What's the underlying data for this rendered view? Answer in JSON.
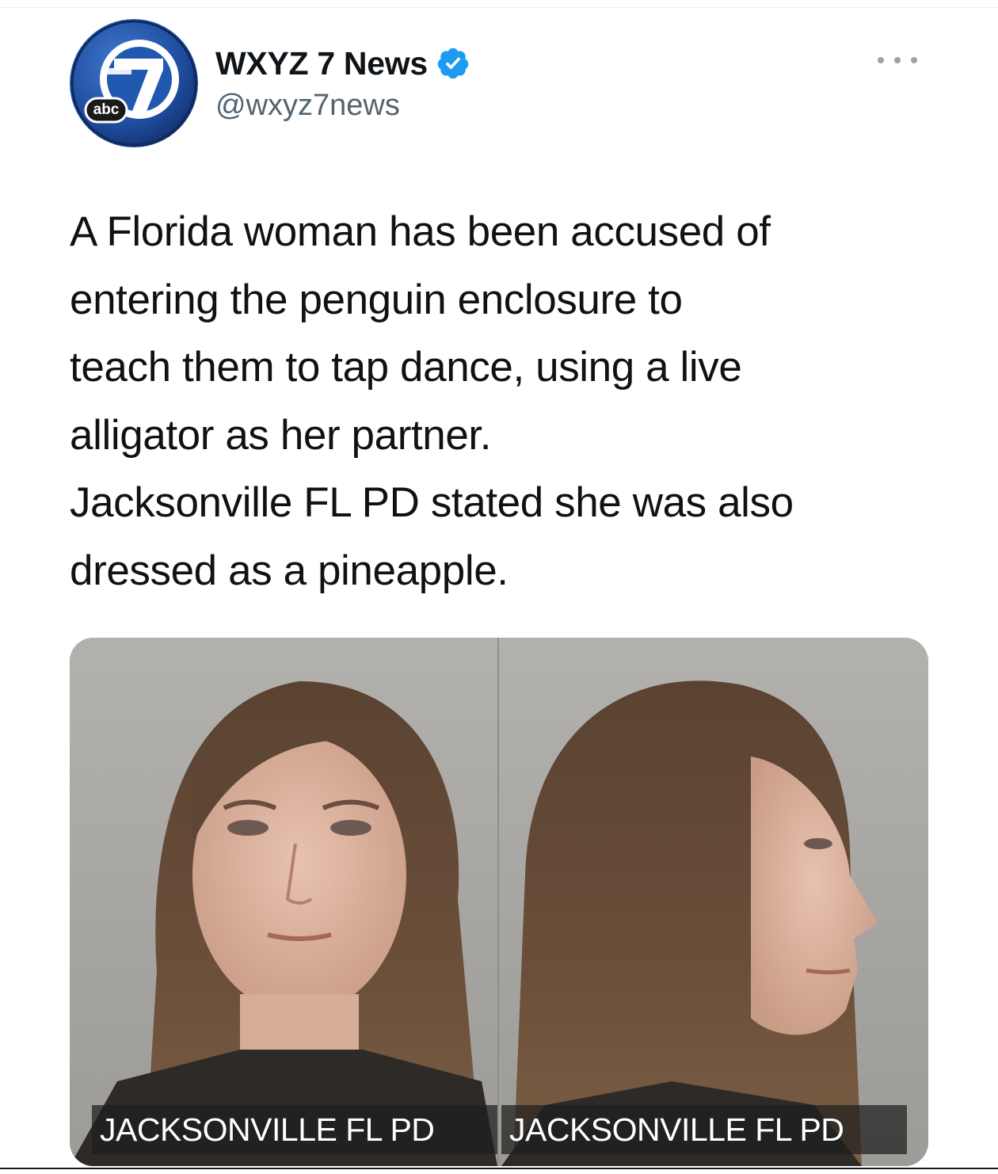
{
  "tweet": {
    "author": {
      "display_name": "WXYZ 7 News",
      "handle": "@wxyz7news",
      "verified": true,
      "avatar_badge_text": "abc",
      "avatar_number": "7"
    },
    "menu_icon": "more-horizontal-icon",
    "text_lines": [
      "A Florida woman has been accused of",
      "entering the penguin enclosure to",
      "teach them to tap dance, using a live",
      "alligator as her partner.",
      "Jacksonville FL PD stated she was also",
      "dressed as a pineapple."
    ],
    "media": {
      "captions": [
        "JACKSONVILLE FL PD",
        "JACKSONVILLE FL PD"
      ]
    }
  },
  "colors": {
    "verified_blue": "#1d9bf0",
    "handle_gray": "#536471",
    "avatar_blue": "#1f4fa0"
  }
}
